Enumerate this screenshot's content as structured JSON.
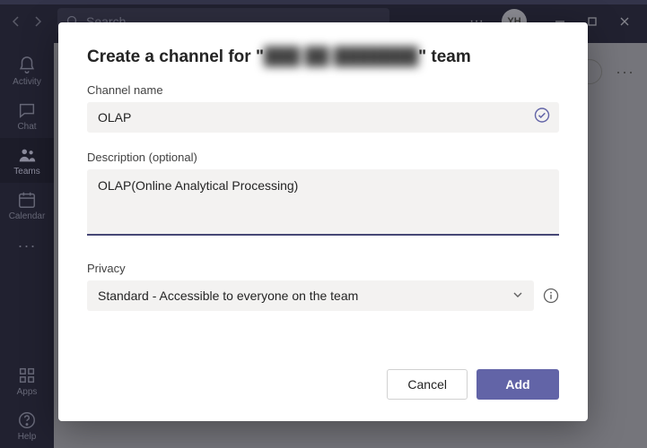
{
  "titlebar": {
    "search_placeholder": "Search",
    "avatar_initials": "YH"
  },
  "leftrail": {
    "activity": "Activity",
    "chat": "Chat",
    "teams": "Teams",
    "calendar": "Calendar",
    "apps": "Apps",
    "help": "Help"
  },
  "modal": {
    "title_prefix": "Create a channel for \"",
    "title_team_obscured": "███  ██ ███████",
    "title_suffix": "\" team",
    "channel_name_label": "Channel name",
    "channel_name_value": "OLAP",
    "description_label": "Description (optional)",
    "description_value": "OLAP(Online Analytical Processing)",
    "privacy_label": "Privacy",
    "privacy_value": "Standard - Accessible to everyone on the team",
    "cancel_label": "Cancel",
    "add_label": "Add"
  }
}
